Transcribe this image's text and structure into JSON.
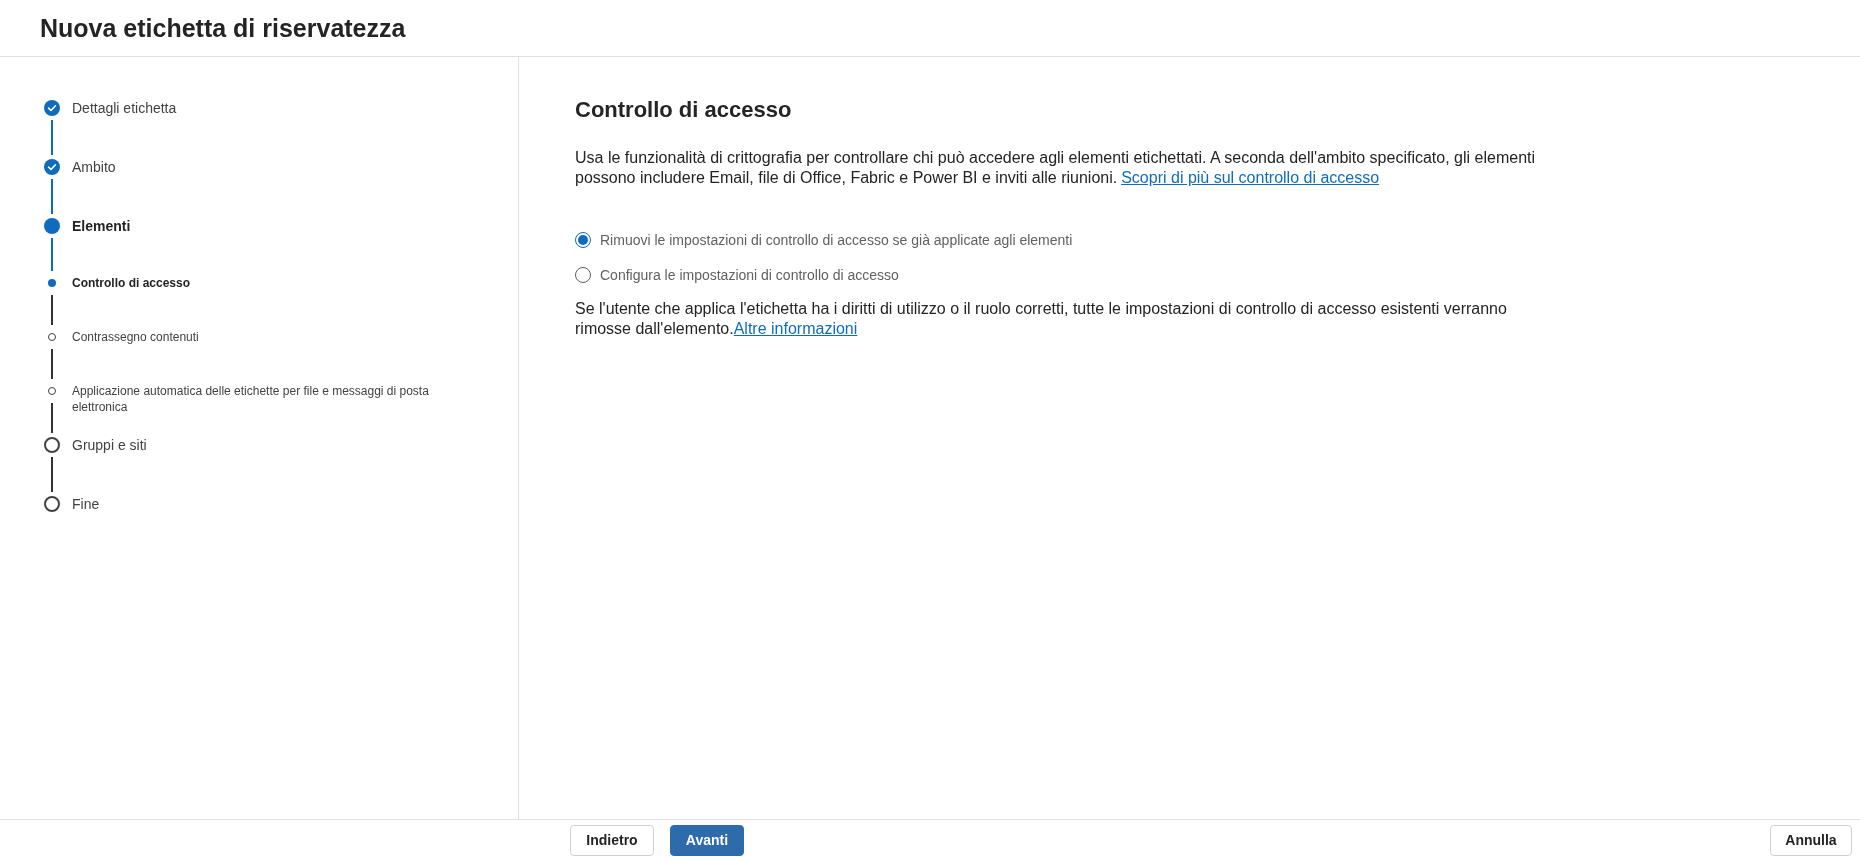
{
  "header": {
    "title": "Nuova etichetta di riservatezza"
  },
  "steps": [
    {
      "label": "Dettagli etichetta",
      "completed": true,
      "current": false
    },
    {
      "label": "Ambito",
      "completed": true,
      "current": false
    },
    {
      "label": "Elementi",
      "completed": false,
      "current": true,
      "children": [
        {
          "label": "Controllo di accesso",
          "completed": false,
          "current": true
        },
        {
          "label": "Contrassegno contenuti",
          "completed": false,
          "current": false
        },
        {
          "label": "Applicazione automatica delle etichette per file e messaggi di posta elettronica",
          "completed": false,
          "current": false
        }
      ]
    },
    {
      "label": "Gruppi e siti",
      "completed": false,
      "current": false
    },
    {
      "label": "Fine",
      "completed": false,
      "current": false
    }
  ],
  "content": {
    "heading": "Controllo di accesso",
    "description": "Usa le funzionalità di crittografia per controllare chi può accedere agli elementi etichettati. A seconda dell'ambito specificato, gli elementi possono includere Email, file di Office, Fabric e Power BI e inviti alle riunioni.",
    "description_link": "Scopri di più sul controllo di accesso",
    "options": [
      {
        "label": "Rimuovi le impostazioni di controllo di accesso se già applicate agli elementi",
        "selected": true
      },
      {
        "label": "Configura le impostazioni di controllo di accesso",
        "selected": false
      }
    ],
    "note": "Se l'utente che applica l'etichetta ha i diritti di utilizzo o il ruolo corretti, tutte le impostazioni di controllo di accesso esistenti verranno rimosse dall'elemento.",
    "note_link": "Altre informazioni"
  },
  "footer": {
    "buttons": [
      {
        "label": "Indietro",
        "kind": "back"
      },
      {
        "label": "Avanti",
        "kind": "next"
      }
    ],
    "cancel_button": {
      "label": "Annulla"
    }
  }
}
